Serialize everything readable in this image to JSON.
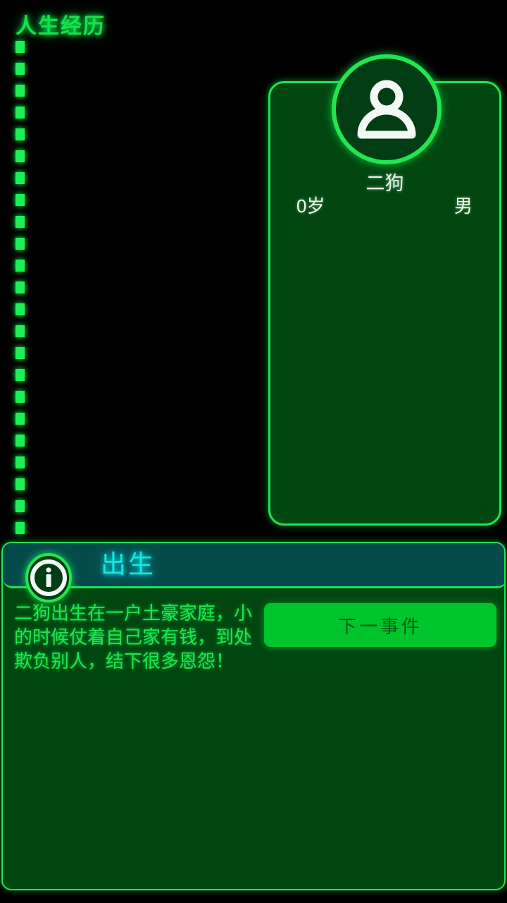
{
  "page": {
    "title": "人生经历",
    "accent_green": "#1cf055",
    "accent_cyan": "#12e8e8",
    "background": "#000000",
    "card_fill": "#014610",
    "header_fill": "#064b4b",
    "button_fill": "#00c42c"
  },
  "timeline": {
    "name": "dashed-timeline",
    "dash_color": "#1cf055"
  },
  "character": {
    "avatar_icon": "person-icon",
    "name": "二狗",
    "age": "0岁",
    "gender": "男"
  },
  "event": {
    "icon": "info-icon",
    "title": "出生",
    "description": "二狗出生在一户土豪家庭，小的时候仗着自己家有钱，到处欺负别人，结下很多恩怨！",
    "next_button_label": "下一事件"
  }
}
